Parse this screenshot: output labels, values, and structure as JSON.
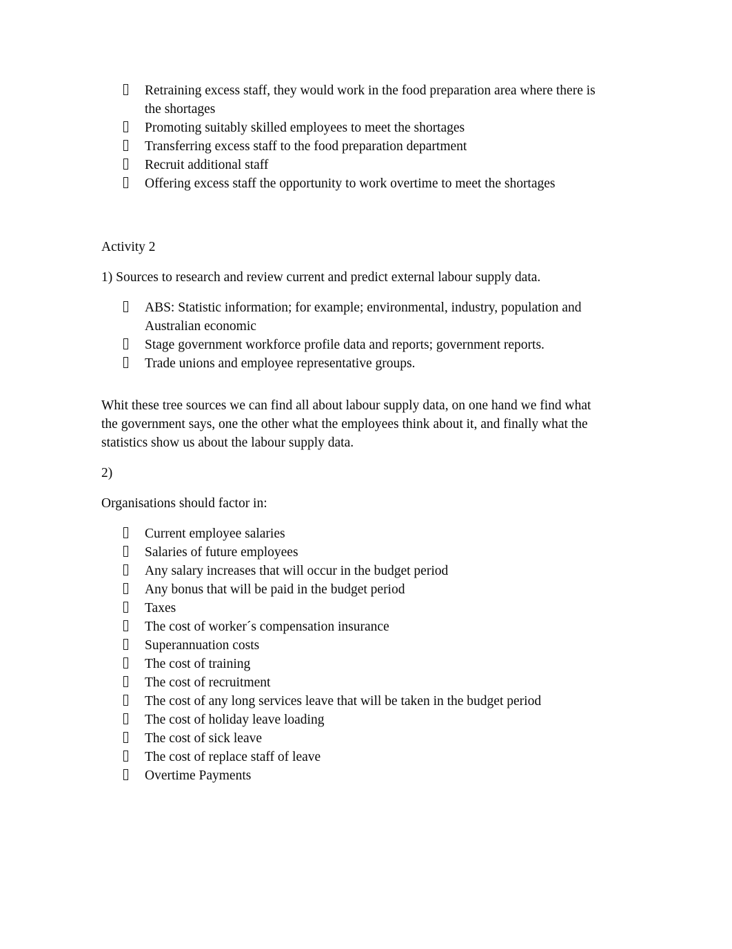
{
  "document": {
    "bullet_marker_glyph": "missing-glyph-box",
    "text_color": "#0a0a0a",
    "background_color": "#ffffff",
    "blocks": [
      {
        "type": "bullet-list",
        "name": "strategies-list",
        "items": [
          "Retraining excess staff, they would work in the food preparation area where there is the shortages",
          "Promoting suitably skilled employees to meet the shortages",
          "Transferring excess staff to the food preparation department",
          "Recruit additional staff",
          "Offering excess staff the opportunity to work overtime to meet the shortages"
        ]
      },
      {
        "type": "heading",
        "name": "activity-2-heading",
        "text": "Activity 2"
      },
      {
        "type": "paragraph",
        "name": "question-1",
        "text": "1) Sources to research and review current and predict external labour supply data."
      },
      {
        "type": "bullet-list",
        "name": "sources-list",
        "items": [
          "ABS: Statistic information; for example; environmental, industry, population and Australian economic",
          "Stage government workforce profile data and reports; government reports.",
          "Trade unions and employee representative groups."
        ]
      },
      {
        "type": "paragraph",
        "name": "sources-explanation",
        "text": "Whit these tree sources we can find all about labour supply data, on one hand we find what the government says, one the other what the employees think about it, and finally what the statistics show us about the labour supply data."
      },
      {
        "type": "paragraph",
        "name": "question-2",
        "text": "2)"
      },
      {
        "type": "paragraph",
        "name": "factors-intro",
        "text": "Organisations should factor in:"
      },
      {
        "type": "bullet-list",
        "name": "cost-factors-list",
        "items": [
          "Current employee salaries",
          "Salaries of future employees",
          "Any salary increases that will occur in the budget period",
          "Any bonus that will be paid in the budget period",
          "Taxes",
          "The cost of worker´s compensation insurance",
          "Superannuation costs",
          "The cost of training",
          "The cost of recruitment",
          "The cost of any long services leave that will be taken in the budget period",
          "The cost of holiday leave loading",
          "The cost of sick leave",
          "The cost of replace staff of leave",
          "Overtime Payments"
        ]
      }
    ]
  }
}
